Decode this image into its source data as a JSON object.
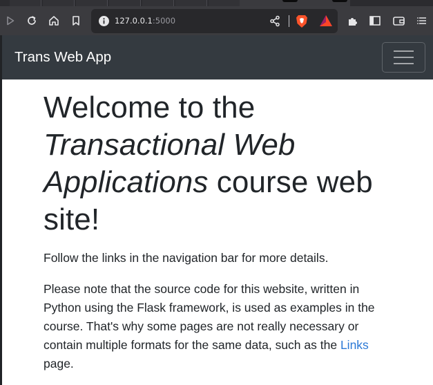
{
  "browser": {
    "url_host": "127.0.0.1",
    "url_port": ":5000",
    "icons": [
      "play-icon",
      "reload-icon",
      "home-icon",
      "bookmark-icon",
      "site-info-icon",
      "share-icon",
      "brave-shields-icon",
      "brave-rewards-icon",
      "extensions-icon",
      "sidebar-icon",
      "wallet-icon",
      "menu-icon"
    ]
  },
  "navbar": {
    "brand": "Trans Web App",
    "toggler_icon": "hamburger-icon"
  },
  "content": {
    "headline_part1": "Welcome to the ",
    "headline_italic": "Transactional Web Applications",
    "headline_part2": " course web site!",
    "intro": "Follow the links in the navigation bar for more details.",
    "note_before_link": "Please note that the source code for this website, written in Python using the Flask framework, is used as examples in the course. That's why some pages are not really necessary or contain multiple formats for the same data, such as the ",
    "note_link": "Links",
    "note_after_link": " page."
  },
  "colors": {
    "navbar_bg": "#343a40",
    "link": "#2a78d6",
    "text": "#212529"
  }
}
